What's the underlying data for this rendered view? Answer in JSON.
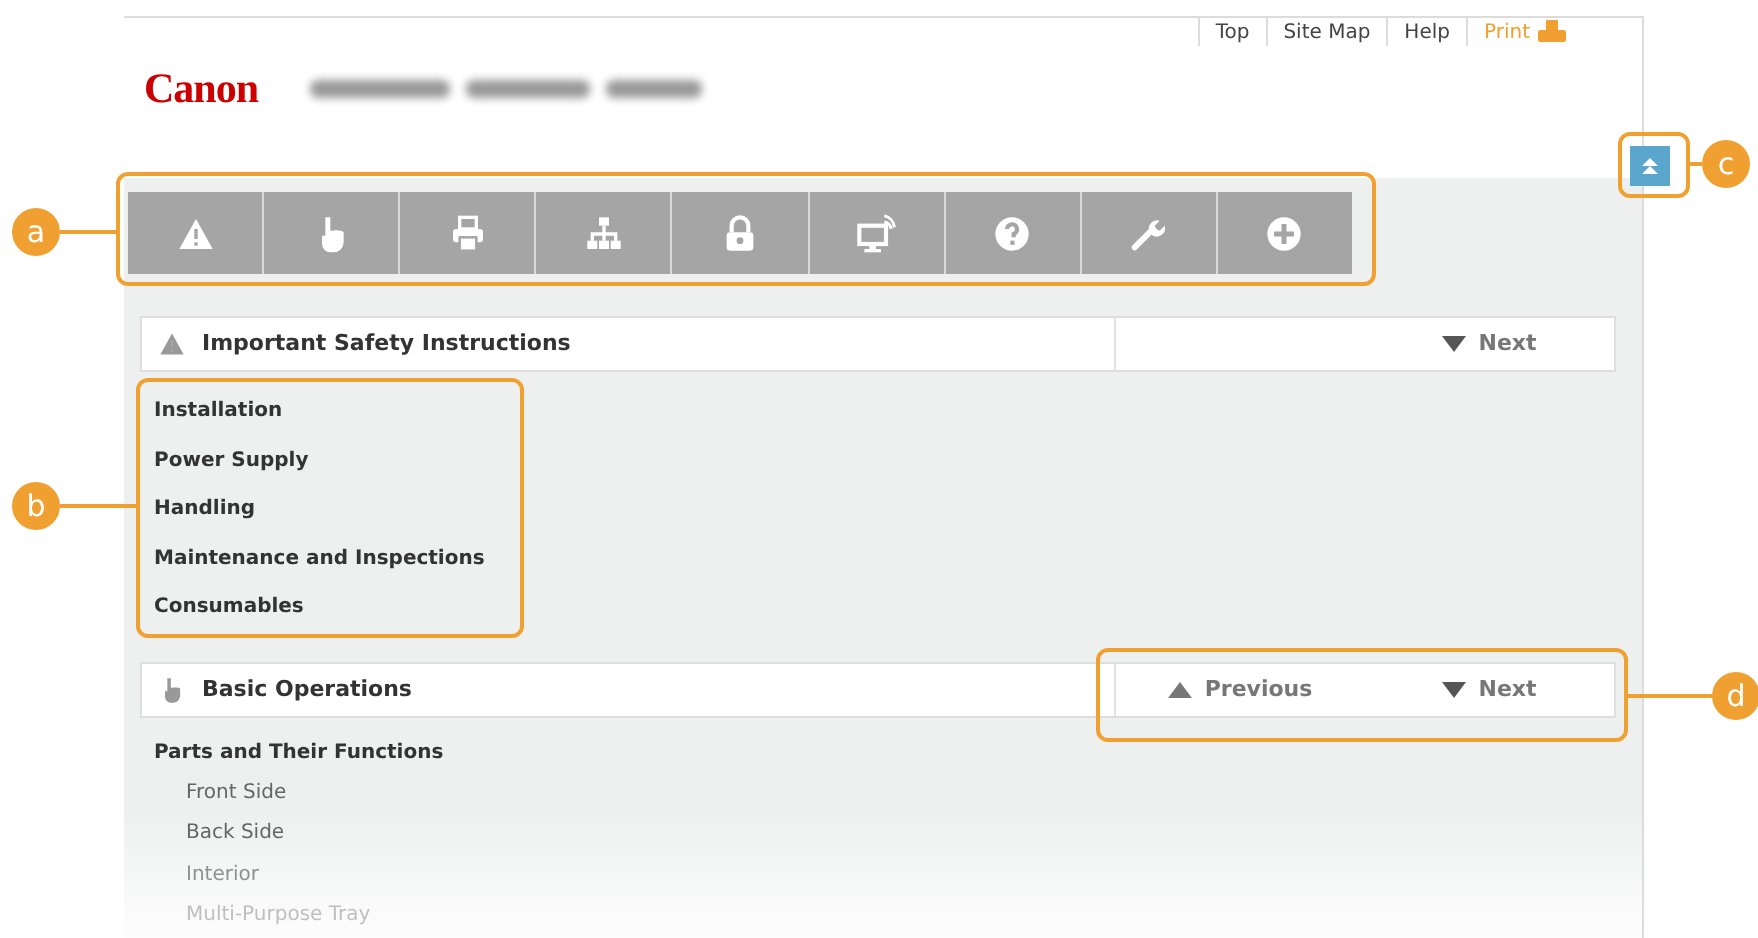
{
  "header": {
    "logo": "Canon",
    "links": [
      {
        "label": "Top",
        "kind": "text"
      },
      {
        "label": "Site Map",
        "kind": "text"
      },
      {
        "label": "Help",
        "kind": "text"
      },
      {
        "label": "Print",
        "kind": "print"
      }
    ]
  },
  "toolbar": [
    {
      "kind": "warning"
    },
    {
      "kind": "hand"
    },
    {
      "kind": "printer"
    },
    {
      "kind": "network"
    },
    {
      "kind": "lock"
    },
    {
      "kind": "monitor"
    },
    {
      "kind": "help"
    },
    {
      "kind": "wrench"
    },
    {
      "kind": "plus"
    }
  ],
  "sections": [
    {
      "title": "Important Safety Instructions",
      "kind": "warning",
      "nav": [
        {
          "label": "Next",
          "kind": "down"
        }
      ],
      "items": [
        {
          "label": "Installation"
        },
        {
          "label": "Power Supply"
        },
        {
          "label": "Handling"
        },
        {
          "label": "Maintenance and Inspections"
        },
        {
          "label": "Consumables"
        }
      ]
    },
    {
      "title": "Basic Operations",
      "kind": "hand",
      "nav": [
        {
          "label": "Previous",
          "kind": "up"
        },
        {
          "label": "Next",
          "kind": "down"
        }
      ],
      "items": [
        {
          "label": "Parts and Their Functions",
          "children": [
            {
              "label": "Front Side"
            },
            {
              "label": "Back Side"
            },
            {
              "label": "Interior"
            },
            {
              "label": "Multi-Purpose Tray"
            }
          ]
        }
      ]
    }
  ],
  "callouts": [
    {
      "letter": "a"
    },
    {
      "letter": "b"
    },
    {
      "letter": "c"
    },
    {
      "letter": "d"
    }
  ]
}
